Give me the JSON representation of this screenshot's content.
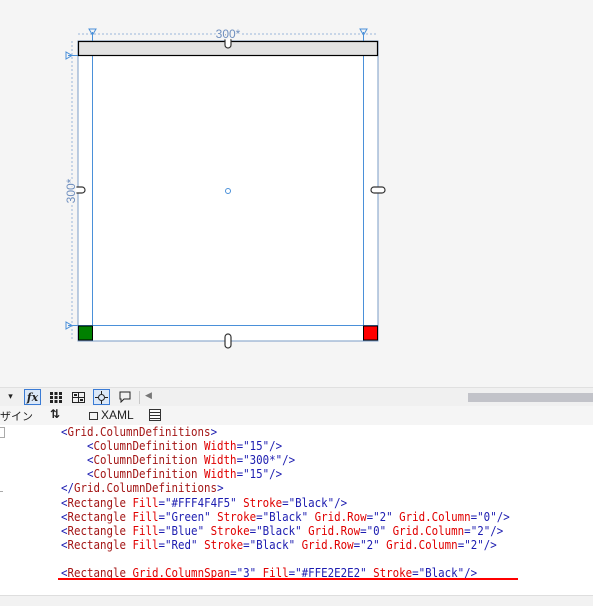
{
  "designer": {
    "column_label": "300*",
    "row_label": "300*",
    "colors": {
      "header_fill": "#E2E2E2",
      "green": "#008000",
      "red": "#FF0000",
      "guide": "#4a90d9"
    }
  },
  "toolbar": {
    "left_icon": "dropdown-arrow-icon",
    "fx_label": "fx",
    "icons": [
      "grid-icon",
      "grid-snap-icon",
      "snap-points-icon",
      "comment-icon"
    ],
    "scroll_left_icon": "scroll-left-arrow-icon"
  },
  "tabs": {
    "design_label": "ザイン",
    "swap_icon": "swap-panes-icon",
    "xaml_label": "XAML",
    "xaml_icon": "xaml-tab-icon",
    "split_icon": "split-view-icon"
  },
  "editor": {
    "lines": [
      [
        {
          "t": "<",
          "c": "b"
        },
        {
          "t": "Grid.ColumnDefinitions",
          "c": "m"
        },
        {
          "t": ">",
          "c": "b"
        }
      ],
      [
        {
          "t": "    <",
          "c": "b"
        },
        {
          "t": "ColumnDefinition",
          "c": "m"
        },
        {
          "t": " Width",
          "c": "r"
        },
        {
          "t": "=\"15\"/>",
          "c": "b"
        }
      ],
      [
        {
          "t": "    <",
          "c": "b"
        },
        {
          "t": "ColumnDefinition",
          "c": "m"
        },
        {
          "t": " Width",
          "c": "r"
        },
        {
          "t": "=\"300*\"/>",
          "c": "b"
        }
      ],
      [
        {
          "t": "    <",
          "c": "b"
        },
        {
          "t": "ColumnDefinition",
          "c": "m"
        },
        {
          "t": " Width",
          "c": "r"
        },
        {
          "t": "=\"15\"/>",
          "c": "b"
        }
      ],
      [
        {
          "t": "</",
          "c": "b"
        },
        {
          "t": "Grid.ColumnDefinitions",
          "c": "m"
        },
        {
          "t": ">",
          "c": "b"
        }
      ],
      [
        {
          "t": "<",
          "c": "b"
        },
        {
          "t": "Rectangle",
          "c": "m"
        },
        {
          "t": " Fill",
          "c": "r"
        },
        {
          "t": "=\"#FFF4F4F5\"",
          "c": "b"
        },
        {
          "t": " Stroke",
          "c": "r"
        },
        {
          "t": "=\"Black\"/>",
          "c": "b"
        }
      ],
      [
        {
          "t": "<",
          "c": "b"
        },
        {
          "t": "Rectangle",
          "c": "m"
        },
        {
          "t": " Fill",
          "c": "r"
        },
        {
          "t": "=\"Green\"",
          "c": "b"
        },
        {
          "t": " Stroke",
          "c": "r"
        },
        {
          "t": "=\"Black\"",
          "c": "b"
        },
        {
          "t": " Grid.Row",
          "c": "r"
        },
        {
          "t": "=\"2\"",
          "c": "b"
        },
        {
          "t": " Grid.Column",
          "c": "r"
        },
        {
          "t": "=\"0\"/>",
          "c": "b"
        }
      ],
      [
        {
          "t": "<",
          "c": "b"
        },
        {
          "t": "Rectangle",
          "c": "m"
        },
        {
          "t": " Fill",
          "c": "r"
        },
        {
          "t": "=\"Blue\"",
          "c": "b"
        },
        {
          "t": " Stroke",
          "c": "r"
        },
        {
          "t": "=\"Black\"",
          "c": "b"
        },
        {
          "t": " Grid.Row",
          "c": "r"
        },
        {
          "t": "=\"0\"",
          "c": "b"
        },
        {
          "t": " Grid.Column",
          "c": "r"
        },
        {
          "t": "=\"2\"/>",
          "c": "b"
        }
      ],
      [
        {
          "t": "<",
          "c": "b"
        },
        {
          "t": "Rectangle",
          "c": "m"
        },
        {
          "t": " Fill",
          "c": "r"
        },
        {
          "t": "=\"Red\"",
          "c": "b"
        },
        {
          "t": " Stroke",
          "c": "r"
        },
        {
          "t": "=\"Black\"",
          "c": "b"
        },
        {
          "t": " Grid.Row",
          "c": "r"
        },
        {
          "t": "=\"2\"",
          "c": "b"
        },
        {
          "t": " Grid.Column",
          "c": "r"
        },
        {
          "t": "=\"2\"/>",
          "c": "b"
        }
      ],
      [],
      [
        {
          "t": "<",
          "c": "b"
        },
        {
          "t": "Rectangle",
          "c": "m"
        },
        {
          "t": " Grid.ColumnSpan",
          "c": "r"
        },
        {
          "t": "=\"3\"",
          "c": "b"
        },
        {
          "t": " Fill",
          "c": "r"
        },
        {
          "t": "=\"#FFE2E2E2\"",
          "c": "b"
        },
        {
          "t": " Stroke",
          "c": "r"
        },
        {
          "t": "=\"Black\"/>",
          "c": "b"
        }
      ]
    ],
    "underline_color": "#FF0000"
  }
}
